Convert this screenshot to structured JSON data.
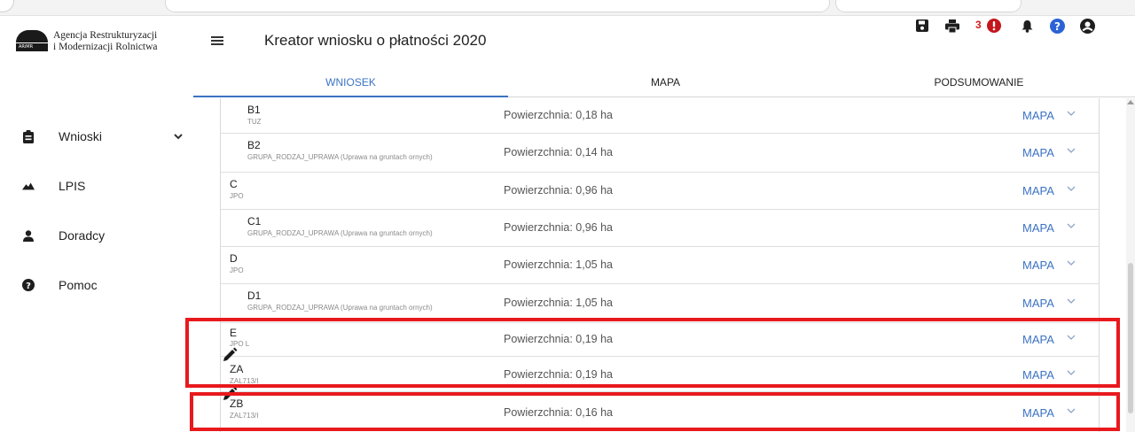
{
  "org": {
    "line1": "Agencja Restrukturyzacji",
    "line2": "i Modernizacji Rolnictwa",
    "logo_small": "ARiMR"
  },
  "header": {
    "title": "Kreator wniosku o płatności 2020",
    "error_count": "3",
    "icons": [
      "save-icon",
      "print-icon",
      "error-alert-icon",
      "bell-icon",
      "help-icon",
      "user-icon"
    ]
  },
  "sidebar": {
    "items": [
      {
        "label": "Wnioski",
        "icon": "document-icon",
        "expandable": true
      },
      {
        "label": "LPIS",
        "icon": "mountains-icon"
      },
      {
        "label": "Doradcy",
        "icon": "person-icon"
      },
      {
        "label": "Pomoc",
        "icon": "help-circle-icon"
      }
    ]
  },
  "tabs": [
    {
      "label": "WNIOSEK",
      "active": true
    },
    {
      "label": "MAPA",
      "active": false
    },
    {
      "label": "PODSUMOWANIE",
      "active": false
    }
  ],
  "rows": [
    {
      "name": "B1",
      "sub": "TUZ",
      "area": "Powierzchnia: 0,18 ha",
      "action": "MAPA",
      "indent": true
    },
    {
      "name": "B2",
      "sub": "GRUPA_RODZAJ_UPRAWA (Uprawa na gruntach ornych)",
      "area": "Powierzchnia: 0,14 ha",
      "action": "MAPA",
      "indent": true
    },
    {
      "name": "C",
      "sub": "JPO",
      "area": "Powierzchnia: 0,96 ha",
      "action": "MAPA",
      "indent": false
    },
    {
      "name": "C1",
      "sub": "GRUPA_RODZAJ_UPRAWA (Uprawa na gruntach ornych)",
      "area": "Powierzchnia: 0,96 ha",
      "action": "MAPA",
      "indent": true
    },
    {
      "name": "D",
      "sub": "JPO",
      "area": "Powierzchnia: 1,05 ha",
      "action": "MAPA",
      "indent": false
    },
    {
      "name": "D1",
      "sub": "GRUPA_RODZAJ_UPRAWA (Uprawa na gruntach ornych)",
      "area": "Powierzchnia: 1,05 ha",
      "action": "MAPA",
      "indent": true
    },
    {
      "name": "E",
      "sub": "JPO L",
      "area": "Powierzchnia: 0,19 ha",
      "action": "MAPA",
      "indent": false
    },
    {
      "name": "ZA",
      "sub": "ZAL713/I",
      "area": "Powierzchnia: 0,19 ha",
      "action": "MAPA",
      "indent": false
    },
    {
      "name": "ZB",
      "sub": "ZAL713/I",
      "area": "Powierzchnia: 0,16 ha",
      "action": "MAPA",
      "indent": false
    }
  ],
  "colors": {
    "accent": "#3b73c4",
    "highlight": "#e8191d",
    "error": "#d81b1b"
  }
}
